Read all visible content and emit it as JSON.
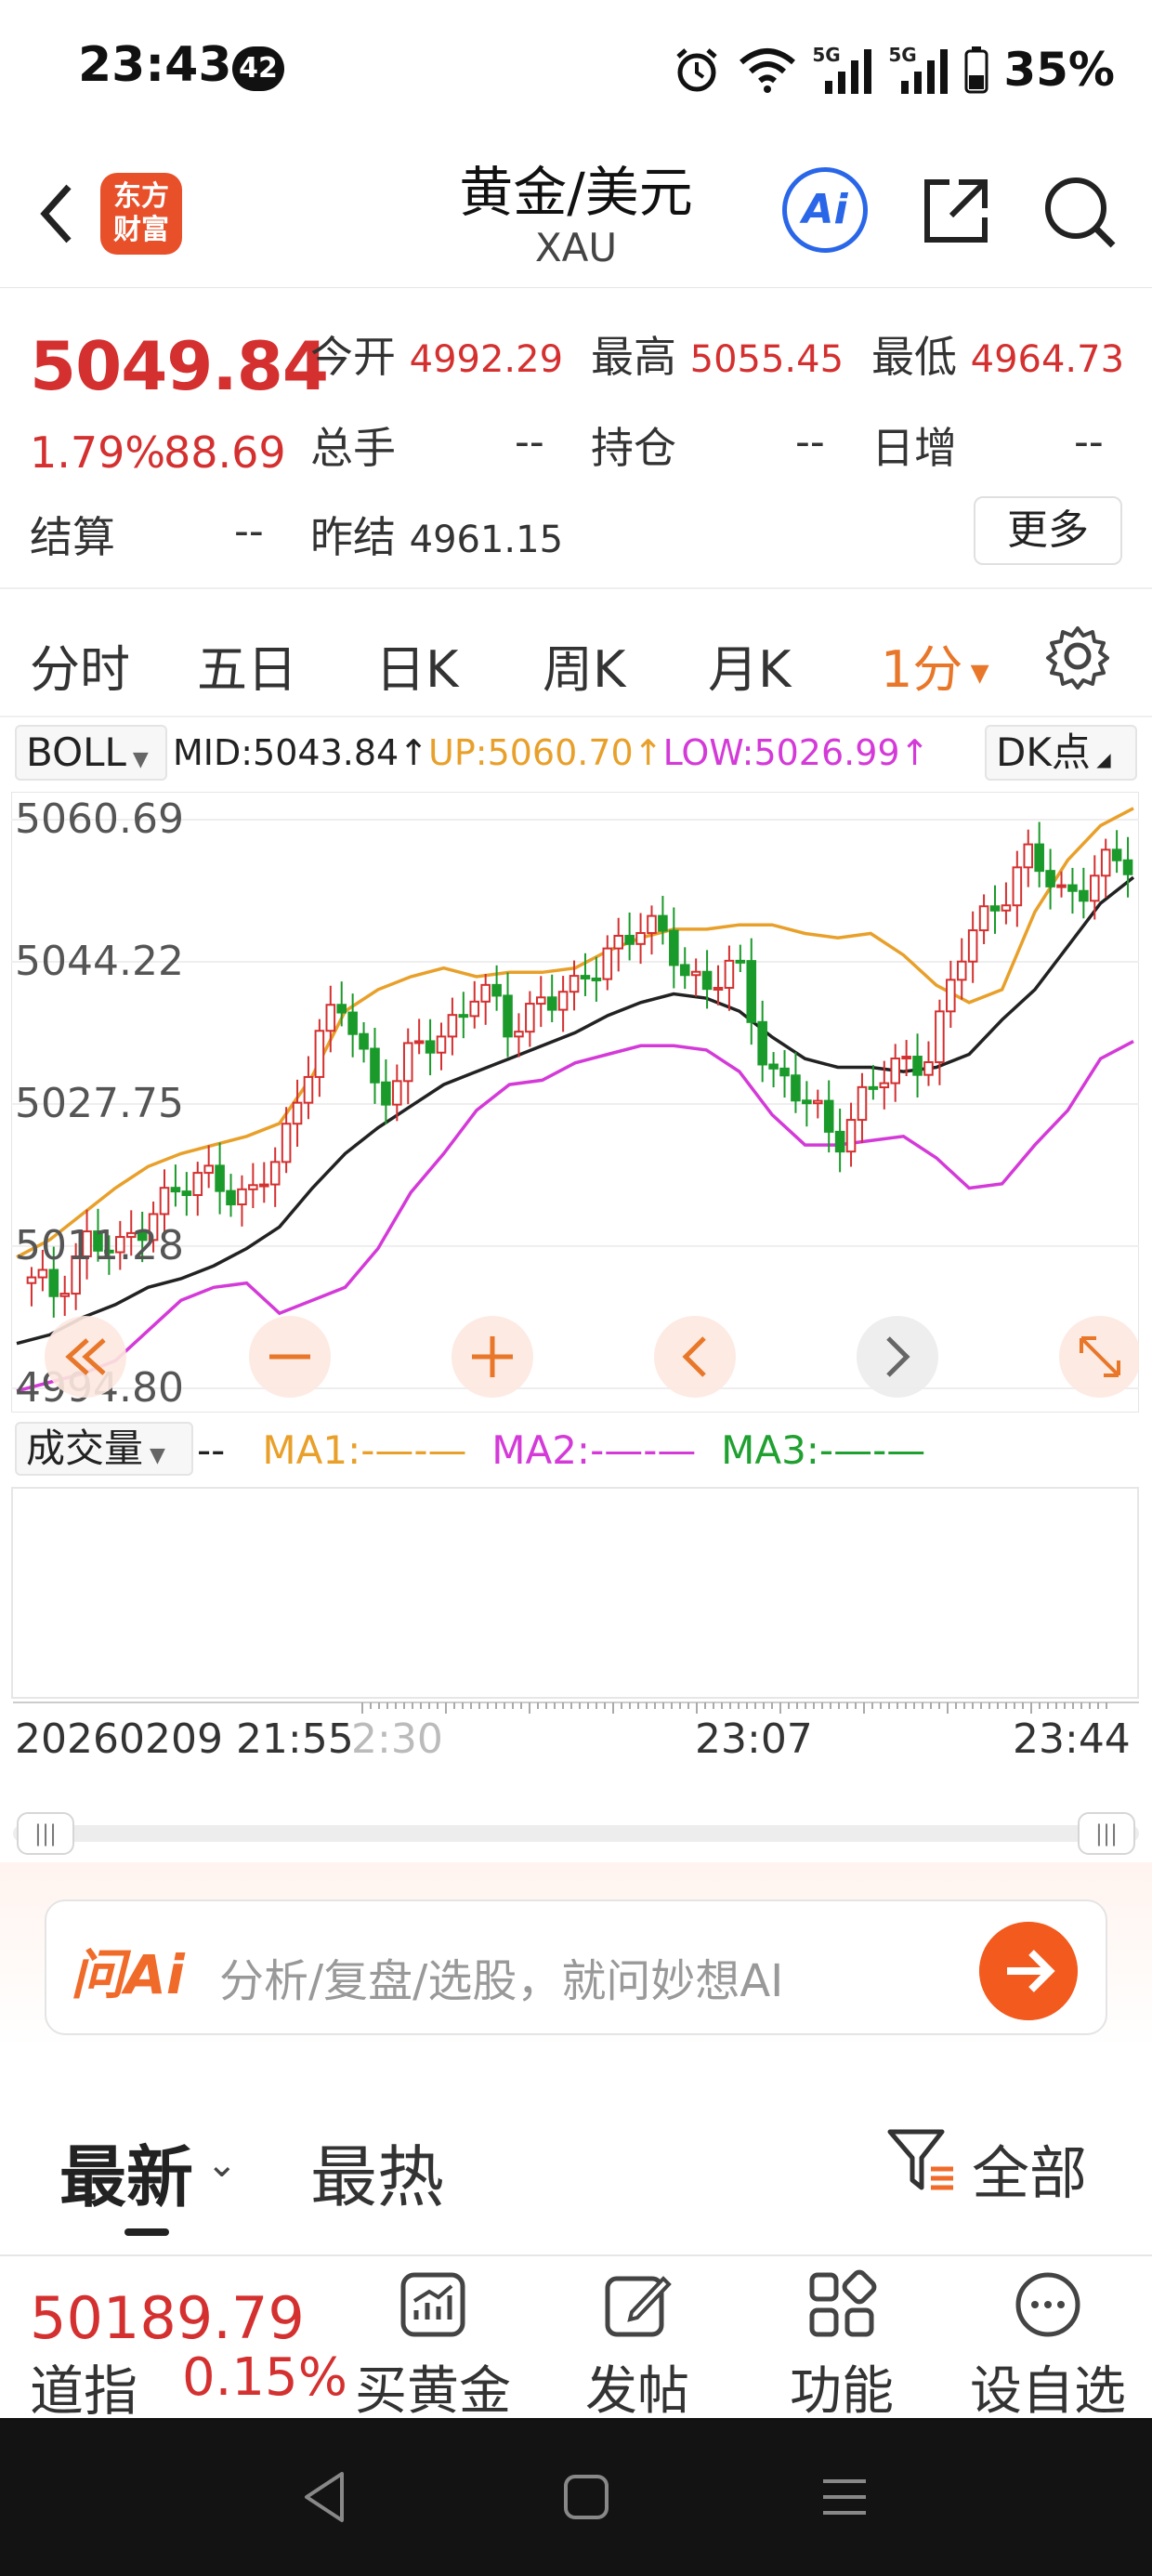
{
  "status": {
    "time": "23:43",
    "notification_count": "42",
    "signal_labels": [
      "5G",
      "5G"
    ],
    "battery": "35%"
  },
  "nav": {
    "logo": "东方财富",
    "title": "黄金/美元",
    "subtitle": "XAU",
    "ai_label": "Ai"
  },
  "quote": {
    "price": "5049.84",
    "change_pct": "1.79%",
    "change": "88.69",
    "open_label": "今开",
    "open": "4992.29",
    "high_label": "最高",
    "high": "5055.45",
    "low_label": "最低",
    "low": "4964.73",
    "volume_label": "总手",
    "volume": "--",
    "oi_label": "持仓",
    "oi": "--",
    "daily_inc_label": "日增",
    "daily_inc": "--",
    "settle_label": "结算",
    "settle": "--",
    "prev_settle_label": "昨结",
    "prev_settle": "4961.15",
    "more": "更多"
  },
  "tabs": [
    {
      "label": "分时"
    },
    {
      "label": "五日"
    },
    {
      "label": "日K"
    },
    {
      "label": "周K"
    },
    {
      "label": "月K"
    },
    {
      "label": "1分"
    }
  ],
  "active_tab": "1分",
  "indicator": {
    "name": "BOLL",
    "mid": "MID:5043.84↑",
    "up": "UP:5060.70↑",
    "low": "LOW:5026.99↑",
    "dk": "DK点"
  },
  "colors": {
    "up": "#d43030",
    "down": "#1a9a2a",
    "upper_band": "#e8a02a",
    "mid_band": "#222222",
    "lower_band": "#d43ad8",
    "accent": "#e8772a"
  },
  "chart_data": {
    "type": "line",
    "y_ticks": [
      "5060.69",
      "5044.22",
      "5027.75",
      "5011.28",
      "4994.80"
    ],
    "ylim": [
      4994.8,
      5060.69
    ],
    "x_ticks": [
      "20260209 21:55",
      "2:30",
      "23:07",
      "23:44"
    ],
    "series": [
      {
        "name": "UP",
        "values": [
          5010.0,
          5012.0,
          5015.0,
          5018.0,
          5020.5,
          5022.0,
          5023.0,
          5024.0,
          5025.5,
          5031.0,
          5038.5,
          5041.0,
          5042.5,
          5043.5,
          5042.5,
          5043.0,
          5043.0,
          5043.5,
          5045.5,
          5047.0,
          5048.0,
          5048.0,
          5048.5,
          5048.5,
          5047.5,
          5047.0,
          5047.5,
          5045.0,
          5041.5,
          5039.5,
          5041.0,
          5050.0,
          5056.0,
          5060.0,
          5062.0
        ]
      },
      {
        "name": "MID",
        "values": [
          5000.0,
          5001.0,
          5003.0,
          5004.5,
          5006.5,
          5007.5,
          5009.0,
          5011.0,
          5013.5,
          5018.0,
          5022.0,
          5025.0,
          5027.5,
          5030.0,
          5031.5,
          5033.0,
          5034.5,
          5036.0,
          5038.0,
          5039.5,
          5040.5,
          5040.0,
          5038.5,
          5035.5,
          5033.0,
          5032.0,
          5032.0,
          5031.5,
          5032.0,
          5033.5,
          5037.5,
          5041.0,
          5046.0,
          5051.0,
          5054.0
        ]
      },
      {
        "name": "LOW",
        "values": [
          4994.5,
          4995.5,
          4996.5,
          4998.0,
          5001.5,
          5005.0,
          5006.5,
          5007.0,
          5003.5,
          5005.0,
          5006.5,
          5011.0,
          5017.5,
          5022.0,
          5027.0,
          5030.0,
          5030.5,
          5032.5,
          5033.5,
          5034.5,
          5034.5,
          5034.0,
          5031.5,
          5026.5,
          5023.0,
          5023.0,
          5023.5,
          5024.0,
          5021.5,
          5018.0,
          5018.5,
          5023.0,
          5027.0,
          5033.0,
          5035.0
        ]
      },
      {
        "name": "Close",
        "values": [
          5007.0,
          5006.0,
          5012.0,
          5010.0,
          5016.0,
          5017.5,
          5020.0,
          5016.0,
          5022.0,
          5035.5,
          5038.5,
          5029.0,
          5033.0,
          5036.0,
          5041.5,
          5036.0,
          5040.5,
          5040.0,
          5046.0,
          5048.0,
          5046.0,
          5041.0,
          5043.5,
          5032.0,
          5028.0,
          5024.0,
          5029.0,
          5032.0,
          5034.5,
          5046.0,
          5052.0,
          5056.0,
          5052.0,
          5054.5,
          5055.5
        ]
      }
    ]
  },
  "volume": {
    "name": "成交量",
    "dashes": "--",
    "ma1": "MA1:-—-—",
    "ma2": "MA2:-—-—",
    "ma3": "MA3:-—-—"
  },
  "ask_ai": {
    "brand": "问Ai",
    "placeholder": "分析/复盘/选股，就问妙想AI"
  },
  "news": {
    "latest": "最新",
    "hot": "最热",
    "filter": "全部"
  },
  "bottom": {
    "index_value": "50189.79",
    "index_name": "道指",
    "index_pct": "0.15%",
    "items": [
      {
        "label": "买黄金",
        "icon": "chart-icon"
      },
      {
        "label": "发帖",
        "icon": "edit-icon"
      },
      {
        "label": "功能",
        "icon": "grid-icon"
      },
      {
        "label": "设自选",
        "icon": "more-icon"
      }
    ]
  }
}
